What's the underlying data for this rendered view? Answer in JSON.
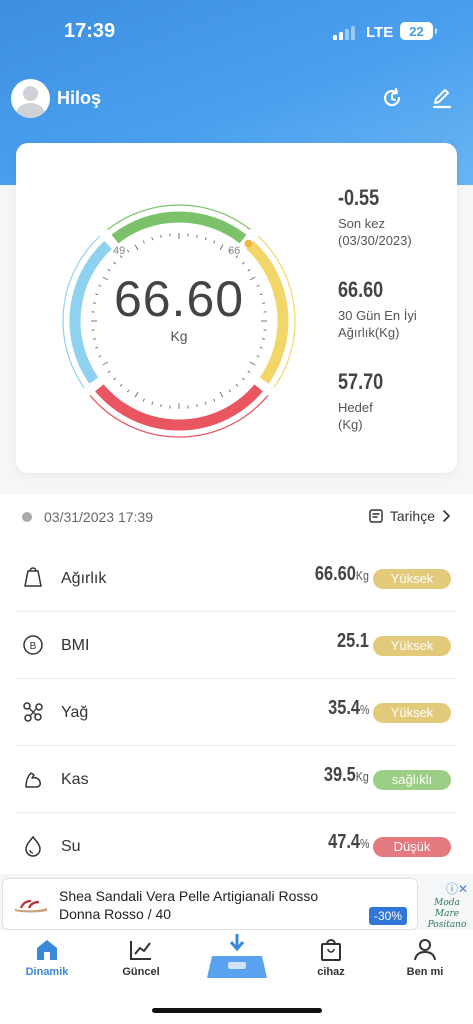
{
  "status_bar": {
    "time": "17:39",
    "network": "LTE",
    "battery": "22"
  },
  "header": {
    "user_name": "Hiloş"
  },
  "gauge": {
    "value": "66.60",
    "unit": "Kg",
    "range_low": "49",
    "range_high": "66"
  },
  "stats": [
    {
      "value": "-0.55",
      "label_line1": "Son kez",
      "label_line2": "(03/30/2023)"
    },
    {
      "value": "66.60",
      "label_line1": "30 Gün En İyi",
      "label_line2": "Ağırlık(Kg)"
    },
    {
      "value": "57.70",
      "label_line1": "Hedef",
      "label_line2": "(Kg)"
    }
  ],
  "record": {
    "datetime": "03/31/2023 17:39",
    "history_label": "Tarihçe"
  },
  "metrics": [
    {
      "label": "Ağırlık",
      "value": "66.60",
      "unit": "Kg",
      "status": "Yüksek",
      "status_color": "#e3c97a",
      "icon": "weight-icon"
    },
    {
      "label": "BMI",
      "value": "25.1",
      "unit": "",
      "status": "Yüksek",
      "status_color": "#e3c97a",
      "icon": "bmi-icon"
    },
    {
      "label": "Yağ",
      "value": "35.4",
      "unit": "%",
      "status": "Yüksek",
      "status_color": "#e3c97a",
      "icon": "fat-icon"
    },
    {
      "label": "Kas",
      "value": "39.5",
      "unit": "Kg",
      "status": "sağlıklı",
      "status_color": "#9bcf86",
      "icon": "muscle-icon"
    },
    {
      "label": "Su",
      "value": "47.4",
      "unit": "%",
      "status": "Düşük",
      "status_color": "#e27a80",
      "icon": "water-drop-icon"
    }
  ],
  "ad": {
    "title": "Shea Sandali Vera Pelle Artigianali Rosso Donna Rosso / 40",
    "discount": "-30%",
    "brand_line1": "Moda Mare",
    "brand_line2": "Positano"
  },
  "tabs": [
    {
      "label": "Dinamik",
      "icon": "home-icon",
      "active": true
    },
    {
      "label": "Güncel",
      "icon": "chart-icon"
    },
    {
      "label": "",
      "icon": "scale-icon"
    },
    {
      "label": "cihaz",
      "icon": "bag-icon"
    },
    {
      "label": "Ben mi",
      "icon": "person-icon"
    }
  ],
  "colors": {
    "accent": "#3a88d8",
    "gauge_green": "#7cc26b",
    "gauge_yellow": "#f3d66a",
    "gauge_red": "#e95560",
    "gauge_blue": "#8fd2f0"
  }
}
